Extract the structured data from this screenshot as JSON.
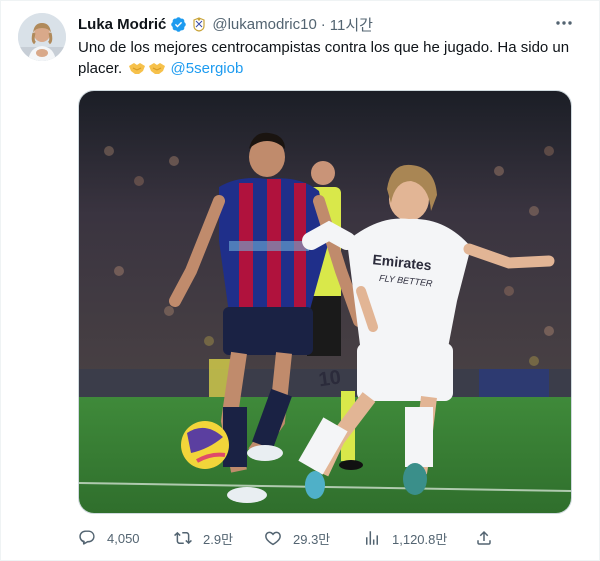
{
  "tweet": {
    "author_name": "Luka Modrić",
    "handle": "@lukamodric10",
    "separator": "·",
    "time": "11시간",
    "text_main": "Uno de los mejores centrocampistas contra los que he jugado. Ha sido un placer. ",
    "mention": "@5sergiob",
    "kit_text": "Emirates\nFLY BETTER",
    "jersey_number": "10"
  },
  "icons": {
    "verified": "verified-badge-icon",
    "affiliation": "team-affiliation-icon",
    "more": "more-icon",
    "reply": "reply-icon",
    "retweet": "retweet-icon",
    "like": "like-icon",
    "views": "views-icon",
    "share": "share-icon",
    "handshake": "handshake-emoji"
  },
  "actions": {
    "replies": "4,050",
    "retweets": "2.9만",
    "likes": "29.3만",
    "views": "1,120.8만"
  },
  "colors": {
    "accent": "#1d9bf0",
    "secondary_text": "#536471",
    "barca_blue": "#1f2f8a",
    "barca_red": "#b0123d",
    "pitch": "#3f8a3a"
  }
}
